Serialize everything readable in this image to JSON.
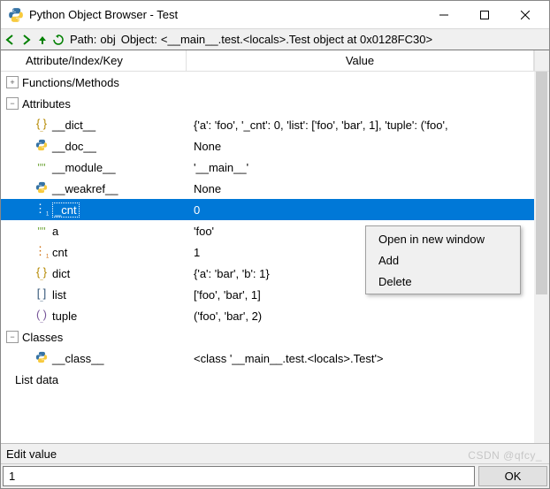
{
  "window": {
    "title": "Python Object Browser - Test"
  },
  "toolbar": {
    "path_label": "Path:",
    "path_value": "obj",
    "object_label": "Object:",
    "object_value": "<__main__.test.<locals>.Test object at 0x0128FC30>"
  },
  "columns": {
    "key": "Attribute/Index/Key",
    "value": "Value"
  },
  "tree": {
    "groups": [
      {
        "label": "Functions/Methods",
        "expanded": false
      },
      {
        "label": "Attributes",
        "expanded": true
      },
      {
        "label": "Classes",
        "expanded": true
      }
    ],
    "attributes": [
      {
        "icon": "{_}",
        "key": "__dict__",
        "value": "{'a': 'foo', '_cnt': 0, 'list': ['foo', 'bar', 1], 'tuple': ('foo',"
      },
      {
        "icon": "py",
        "key": "__doc__",
        "value": "None"
      },
      {
        "icon": "\"\"",
        "key": "__module__",
        "value": "'__main__'"
      },
      {
        "icon": "py",
        "key": "__weakref__",
        "value": "None"
      },
      {
        "icon": "int",
        "key": "_cnt",
        "value": "0",
        "selected": true
      },
      {
        "icon": "\"\"",
        "key": "a",
        "value": "'foo'"
      },
      {
        "icon": "int",
        "key": "cnt",
        "value": "1"
      },
      {
        "icon": "{_}",
        "key": "dict",
        "value": "{'a': 'bar', 'b': 1}"
      },
      {
        "icon": "[_]",
        "key": "list",
        "value": "['foo', 'bar', 1]"
      },
      {
        "icon": "(_)",
        "key": "tuple",
        "value": "('foo', 'bar', 2)"
      }
    ],
    "classes": [
      {
        "icon": "py",
        "key": "__class__",
        "value": "<class '__main__.test.<locals>.Test'>"
      }
    ],
    "list_data_label": "List data"
  },
  "context_menu": {
    "items": [
      {
        "label": "Open in new window"
      },
      {
        "label": "Add"
      },
      {
        "label": "Delete"
      }
    ]
  },
  "bottom": {
    "edit_label": "Edit value",
    "edit_value": "1",
    "ok_label": "OK"
  },
  "icons": {
    "back": "back-arrow",
    "forward": "forward-arrow",
    "up": "up-arrow",
    "refresh": "refresh"
  },
  "watermark": "CSDN @qfcy_"
}
